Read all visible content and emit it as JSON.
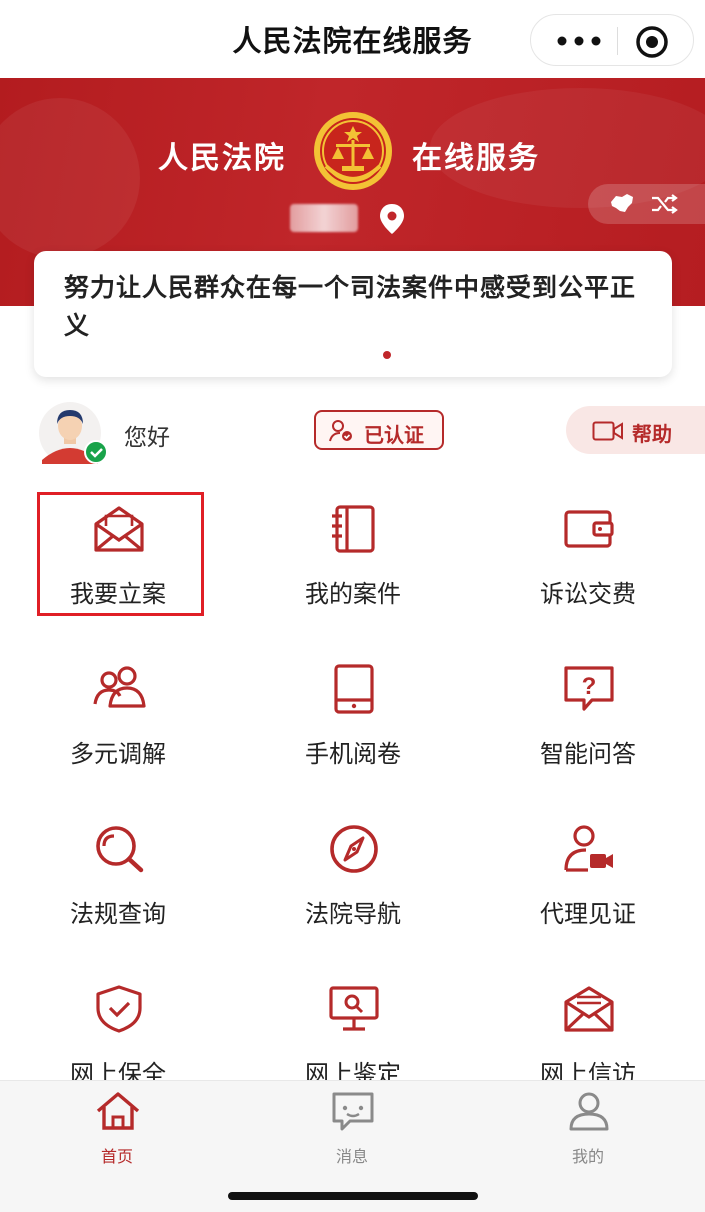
{
  "header": {
    "title": "人民法院在线服务"
  },
  "banner": {
    "title_left": "人民法院",
    "title_right": "在线服务",
    "emblem_icon": "court-emblem",
    "location_icon": "location-pin-icon",
    "switch_icons": [
      "china-map-icon",
      "shuffle-icon"
    ]
  },
  "slogan": {
    "text": "努力让人民群众在每一个司法案件中感受到公平正义"
  },
  "user": {
    "greeting": "您好",
    "verified_label": "已认证",
    "help_label": "帮助"
  },
  "services": [
    {
      "label": "我要立案",
      "icon": "envelope-icon",
      "highlighted": true
    },
    {
      "label": "我的案件",
      "icon": "notebook-icon"
    },
    {
      "label": "诉讼交费",
      "icon": "wallet-icon"
    },
    {
      "label": "多元调解",
      "icon": "people-icon"
    },
    {
      "label": "手机阅卷",
      "icon": "tablet-icon"
    },
    {
      "label": "智能问答",
      "icon": "question-bubble-icon"
    },
    {
      "label": "法规查询",
      "icon": "search-icon"
    },
    {
      "label": "法院导航",
      "icon": "compass-icon"
    },
    {
      "label": "代理见证",
      "icon": "user-video-icon"
    },
    {
      "label": "网上保全",
      "icon": "shield-check-icon"
    },
    {
      "label": "网上鉴定",
      "icon": "monitor-search-icon"
    },
    {
      "label": "网上信访",
      "icon": "mail-letter-icon"
    }
  ],
  "tabs": [
    {
      "label": "首页",
      "icon": "home-icon",
      "active": true
    },
    {
      "label": "消息",
      "icon": "message-icon",
      "active": false
    },
    {
      "label": "我的",
      "icon": "profile-icon",
      "active": false
    }
  ],
  "colors": {
    "brand_red": "#b52a2a",
    "banner_red": "#c0262a",
    "highlight": "#e01f26",
    "tab_inactive": "#888888"
  }
}
